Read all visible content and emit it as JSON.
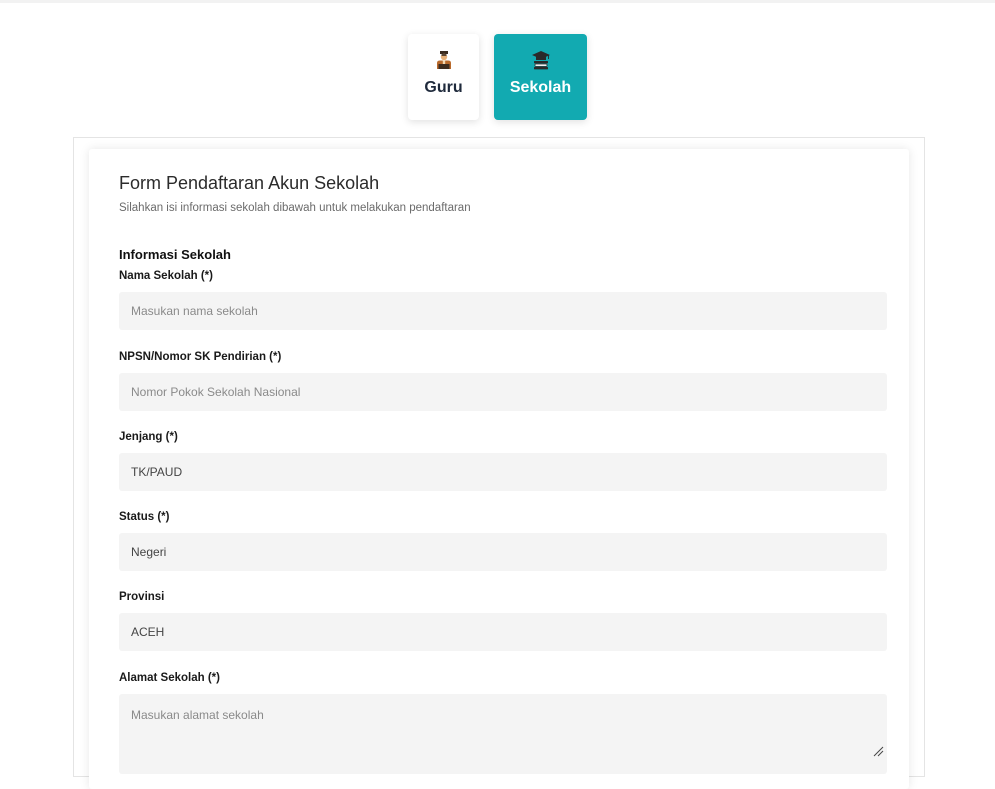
{
  "tabs": {
    "guru": {
      "label": "Guru",
      "icon": "teacher-icon"
    },
    "sekolah": {
      "label": "Sekolah",
      "icon": "school-icon",
      "active": true
    }
  },
  "form": {
    "title": "Form Pendaftaran Akun Sekolah",
    "subtitle": "Silahkan isi informasi sekolah dibawah untuk melakukan pendaftaran",
    "section": "Informasi Sekolah",
    "fields": {
      "nama_sekolah": {
        "label": "Nama Sekolah (*)",
        "placeholder": "Masukan nama sekolah",
        "value": ""
      },
      "npsn": {
        "label": "NPSN/Nomor SK Pendirian (*)",
        "placeholder": "Nomor Pokok Sekolah Nasional",
        "value": ""
      },
      "jenjang": {
        "label": "Jenjang (*)",
        "value": "TK/PAUD"
      },
      "status": {
        "label": "Status (*)",
        "value": "Negeri"
      },
      "provinsi": {
        "label": "Provinsi",
        "value": "ACEH"
      },
      "alamat": {
        "label": "Alamat Sekolah (*)",
        "placeholder": "Masukan alamat sekolah",
        "value": ""
      }
    }
  },
  "colors": {
    "accent": "#12aab1",
    "field_bg": "#f4f4f4"
  }
}
